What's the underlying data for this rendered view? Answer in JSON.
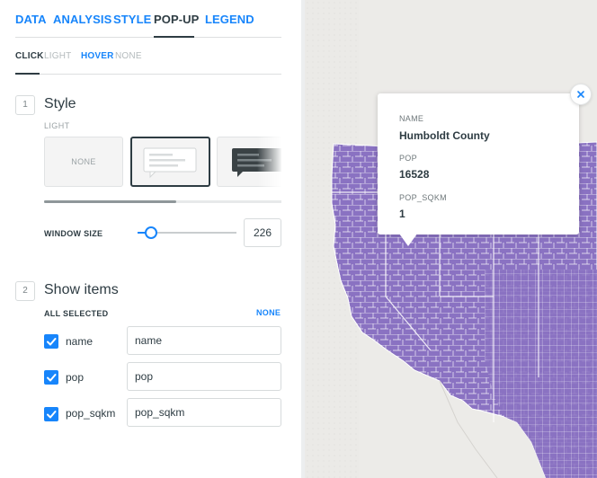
{
  "tabs": [
    "DATA",
    "ANALYSIS",
    "STYLE",
    "POP-UP",
    "LEGEND"
  ],
  "subtabs": {
    "click": "CLICK",
    "light": "LIGHT",
    "hover": "HOVER",
    "none": "NONE"
  },
  "style_section": {
    "step": "1",
    "title": "Style",
    "caption": "LIGHT",
    "cards": {
      "none_label": "NONE"
    },
    "window_size_label": "WINDOW SIZE",
    "window_size_value": "226",
    "window_size_fraction": 0.13
  },
  "items_section": {
    "step": "2",
    "title": "Show items",
    "all_selected": "ALL SELECTED",
    "none_link": "NONE",
    "items": [
      {
        "label": "name",
        "value": "name",
        "checked": true
      },
      {
        "label": "pop",
        "value": "pop",
        "checked": true
      },
      {
        "label": "pop_sqkm",
        "value": "pop_sqkm",
        "checked": true
      }
    ]
  },
  "popup": {
    "fields": [
      {
        "key": "NAME",
        "value": "Humboldt County"
      },
      {
        "key": "POP",
        "value": "16528"
      },
      {
        "key": "POP_SQKM",
        "value": "1"
      }
    ]
  },
  "colors": {
    "accent": "#1785fb",
    "text": "#2e3c43",
    "county_fill": "#8a72c2",
    "county_border": "#ffffff",
    "map_bg": "#ecebe8"
  },
  "icons": {
    "close": "close-icon",
    "check": "check-icon"
  }
}
